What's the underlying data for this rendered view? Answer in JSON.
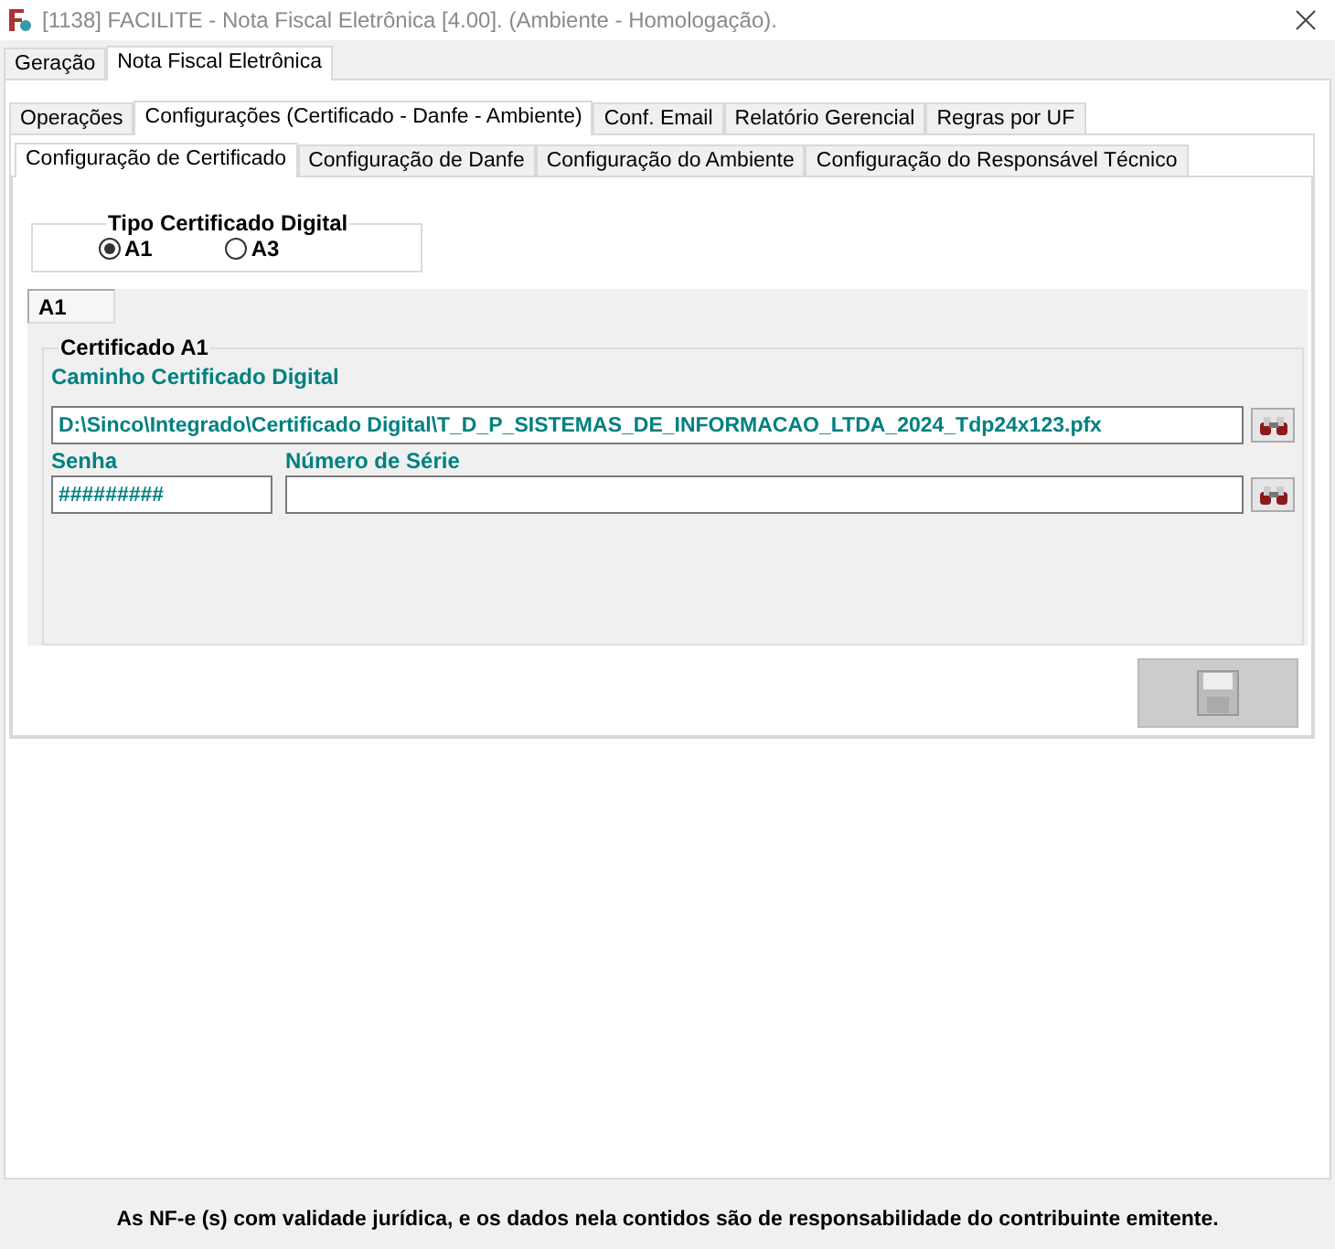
{
  "window": {
    "title": "[1138] FACILITE - Nota Fiscal Eletrônica [4.00]. (Ambiente - Homologação)."
  },
  "main_tabs": [
    {
      "label": "Geração",
      "selected": false
    },
    {
      "label": "Nota Fiscal Eletrônica",
      "selected": true
    }
  ],
  "section_tabs": [
    {
      "label": "Operações",
      "selected": false
    },
    {
      "label": "Configurações (Certificado - Danfe - Ambiente)",
      "selected": true
    },
    {
      "label": "Conf. Email",
      "selected": false
    },
    {
      "label": "Relatório Gerencial",
      "selected": false
    },
    {
      "label": "Regras por UF",
      "selected": false
    }
  ],
  "config_tabs": [
    {
      "label": "Configuração de Certificado",
      "selected": true
    },
    {
      "label": "Configuração de Danfe",
      "selected": false
    },
    {
      "label": "Configuração do Ambiente",
      "selected": false
    },
    {
      "label": "Configuração do Responsável Técnico",
      "selected": false
    }
  ],
  "certificate_type": {
    "legend": "Tipo Certificado Digital",
    "options": [
      {
        "label": "A1",
        "selected": true
      },
      {
        "label": "A3",
        "selected": false
      }
    ]
  },
  "page_tab": {
    "label": "A1"
  },
  "certificate_group": {
    "legend": "Certificado A1",
    "path_label": "Caminho Certificado Digital",
    "path_value": "D:\\Sinco\\Integrado\\Certificado Digital\\T_D_P_SISTEMAS_DE_INFORMACAO_LTDA_2024_Tdp24x123.pfx",
    "password_label": "Senha",
    "password_value": "#########",
    "serial_label": "Número de Série"
  },
  "save_button": {
    "disabled": true
  },
  "footer": "As NF-e (s) com validade jurídica, e os dados nela contidos são de responsabilidade do contribuinte emitente."
}
